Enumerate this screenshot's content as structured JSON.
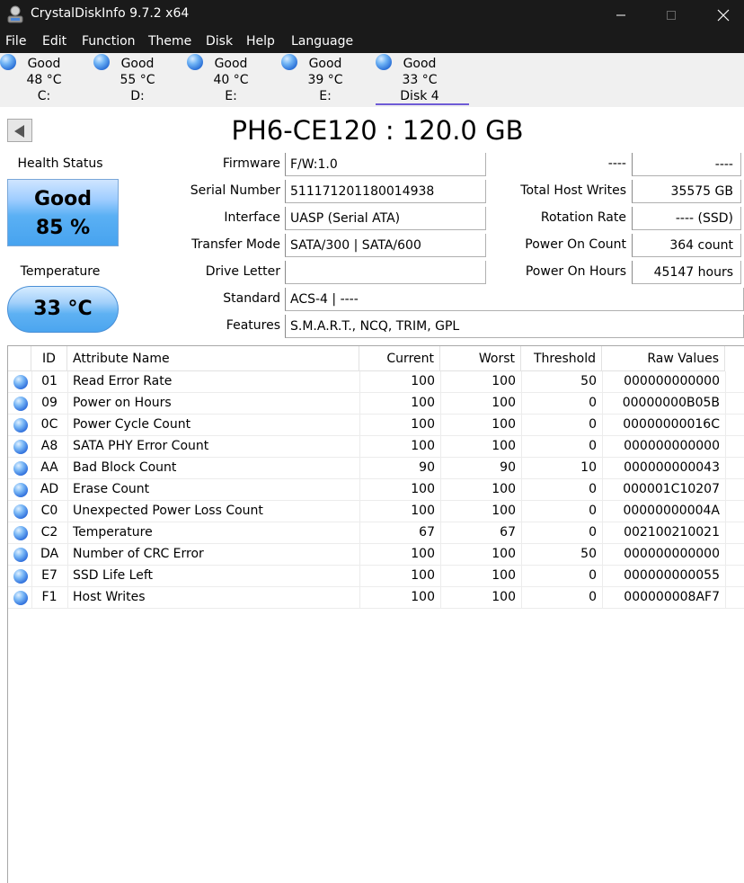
{
  "app": {
    "title": "CrystalDiskInfo 9.7.2 x64"
  },
  "menu": [
    "File",
    "Edit",
    "Function",
    "Theme",
    "Disk",
    "Help",
    "Language"
  ],
  "disks": [
    {
      "status": "Good",
      "temp": "48 °C",
      "label": "C:"
    },
    {
      "status": "Good",
      "temp": "55 °C",
      "label": "D:"
    },
    {
      "status": "Good",
      "temp": "40 °C",
      "label": "E:"
    },
    {
      "status": "Good",
      "temp": "39 °C",
      "label": "E:"
    },
    {
      "status": "Good",
      "temp": "33 °C",
      "label": "Disk 4"
    }
  ],
  "selected_disk_index": 4,
  "disk_title": "PH6-CE120 : 120.0 GB",
  "health": {
    "label": "Health Status",
    "status": "Good",
    "percent": "85 %"
  },
  "temperature": {
    "label": "Temperature",
    "value": "33 °C"
  },
  "info": {
    "firmware_label": "Firmware",
    "firmware": "F/W:1.0",
    "serial_label": "Serial Number",
    "serial": "511171201180014938",
    "interface_label": "Interface",
    "interface": "UASP (Serial ATA)",
    "transfer_label": "Transfer Mode",
    "transfer": "SATA/300 | SATA/600",
    "drive_letter_label": "Drive Letter",
    "drive_letter": "",
    "standard_label": "Standard",
    "standard": "ACS-4 | ----",
    "features_label": "Features",
    "features": "S.M.A.R.T., NCQ, TRIM, GPL",
    "unknown_label": "----",
    "unknown_value": "----",
    "host_writes_label": "Total Host Writes",
    "host_writes": "35575 GB",
    "rotation_label": "Rotation Rate",
    "rotation": "---- (SSD)",
    "power_count_label": "Power On Count",
    "power_count": "364 count",
    "power_hours_label": "Power On Hours",
    "power_hours": "45147 hours"
  },
  "table": {
    "headers": {
      "id": "ID",
      "name": "Attribute Name",
      "current": "Current",
      "worst": "Worst",
      "threshold": "Threshold",
      "raw": "Raw Values"
    },
    "rows": [
      {
        "id": "01",
        "name": "Read Error Rate",
        "current": "100",
        "worst": "100",
        "threshold": "50",
        "raw": "000000000000"
      },
      {
        "id": "09",
        "name": "Power on Hours",
        "current": "100",
        "worst": "100",
        "threshold": "0",
        "raw": "00000000B05B"
      },
      {
        "id": "0C",
        "name": "Power Cycle Count",
        "current": "100",
        "worst": "100",
        "threshold": "0",
        "raw": "00000000016C"
      },
      {
        "id": "A8",
        "name": "SATA PHY Error Count",
        "current": "100",
        "worst": "100",
        "threshold": "0",
        "raw": "000000000000"
      },
      {
        "id": "AA",
        "name": "Bad Block Count",
        "current": "90",
        "worst": "90",
        "threshold": "10",
        "raw": "000000000043"
      },
      {
        "id": "AD",
        "name": "Erase Count",
        "current": "100",
        "worst": "100",
        "threshold": "0",
        "raw": "000001C10207"
      },
      {
        "id": "C0",
        "name": "Unexpected Power Loss Count",
        "current": "100",
        "worst": "100",
        "threshold": "0",
        "raw": "00000000004A"
      },
      {
        "id": "C2",
        "name": "Temperature",
        "current": "67",
        "worst": "67",
        "threshold": "0",
        "raw": "002100210021"
      },
      {
        "id": "DA",
        "name": "Number of CRC Error",
        "current": "100",
        "worst": "100",
        "threshold": "50",
        "raw": "000000000000"
      },
      {
        "id": "E7",
        "name": "SSD Life Left",
        "current": "100",
        "worst": "100",
        "threshold": "0",
        "raw": "000000000055"
      },
      {
        "id": "F1",
        "name": "Host Writes",
        "current": "100",
        "worst": "100",
        "threshold": "0",
        "raw": "000000008AF7"
      }
    ]
  },
  "colors": {
    "titlebar": "#1a1a1a",
    "accent_underline": "#6e5bd6",
    "health_blue": "#5ab0f4"
  }
}
